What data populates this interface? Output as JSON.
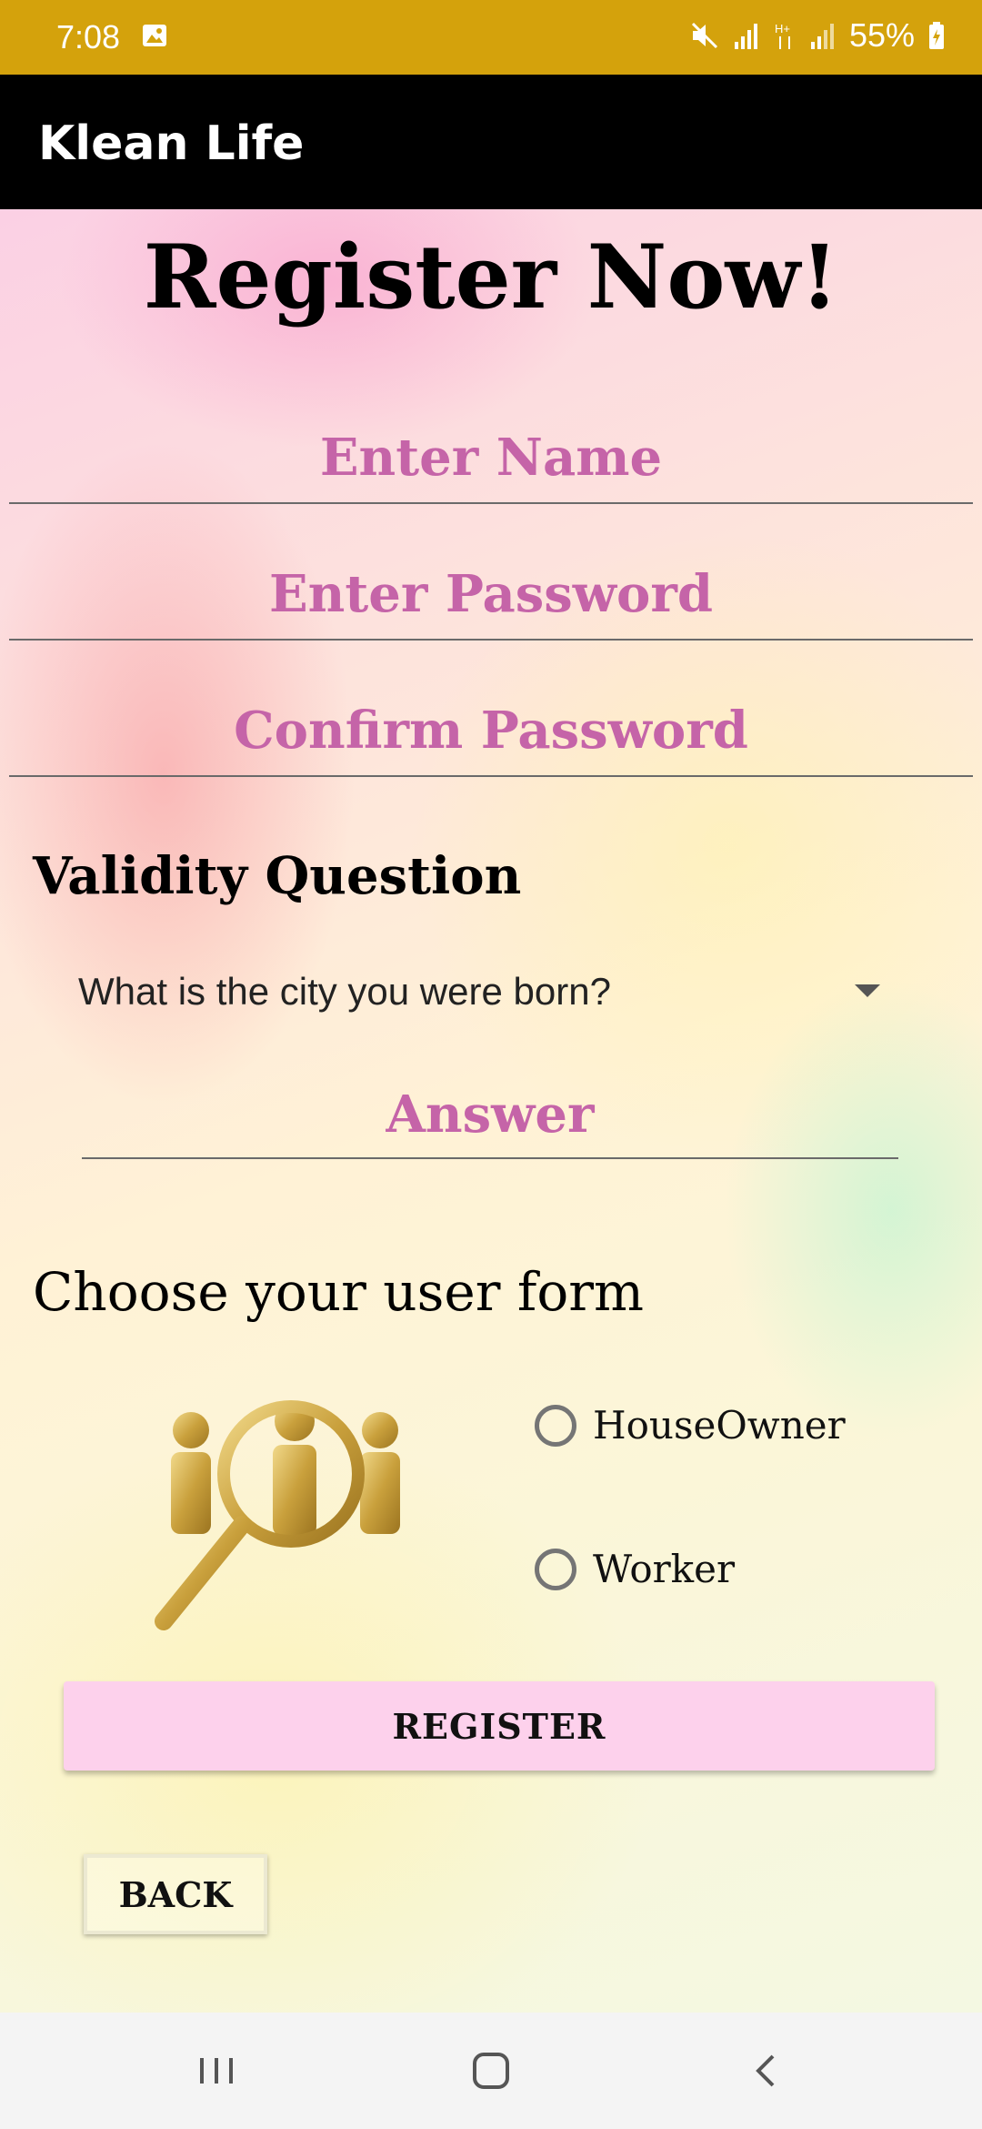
{
  "status_bar": {
    "time": "7:08",
    "battery": "55%",
    "icons": [
      "gallery-icon",
      "mute-icon",
      "signal-icon",
      "data-hplus-icon",
      "signal-icon",
      "battery-charging-icon"
    ]
  },
  "app_bar": {
    "title": "Klean Life"
  },
  "form": {
    "title": "Register Now!",
    "name_placeholder": "Enter Name",
    "password_placeholder": "Enter Password",
    "confirm_password_placeholder": "Confirm Password",
    "validity_label": "Validity Question",
    "question_selected": "What is the city you were born?",
    "answer_placeholder": "Answer",
    "user_form_label": "Choose your user form",
    "radio_options": [
      "HouseOwner",
      "Worker"
    ],
    "register_label": "REGISTER",
    "back_label": "BACK"
  },
  "colors": {
    "status_bar": "#d4a20c",
    "app_bar": "#000000",
    "hint": "#c564a8",
    "register_button": "#fdd1ec"
  },
  "nav_bar": {
    "icons": [
      "recents-icon",
      "home-icon",
      "back-icon"
    ]
  }
}
